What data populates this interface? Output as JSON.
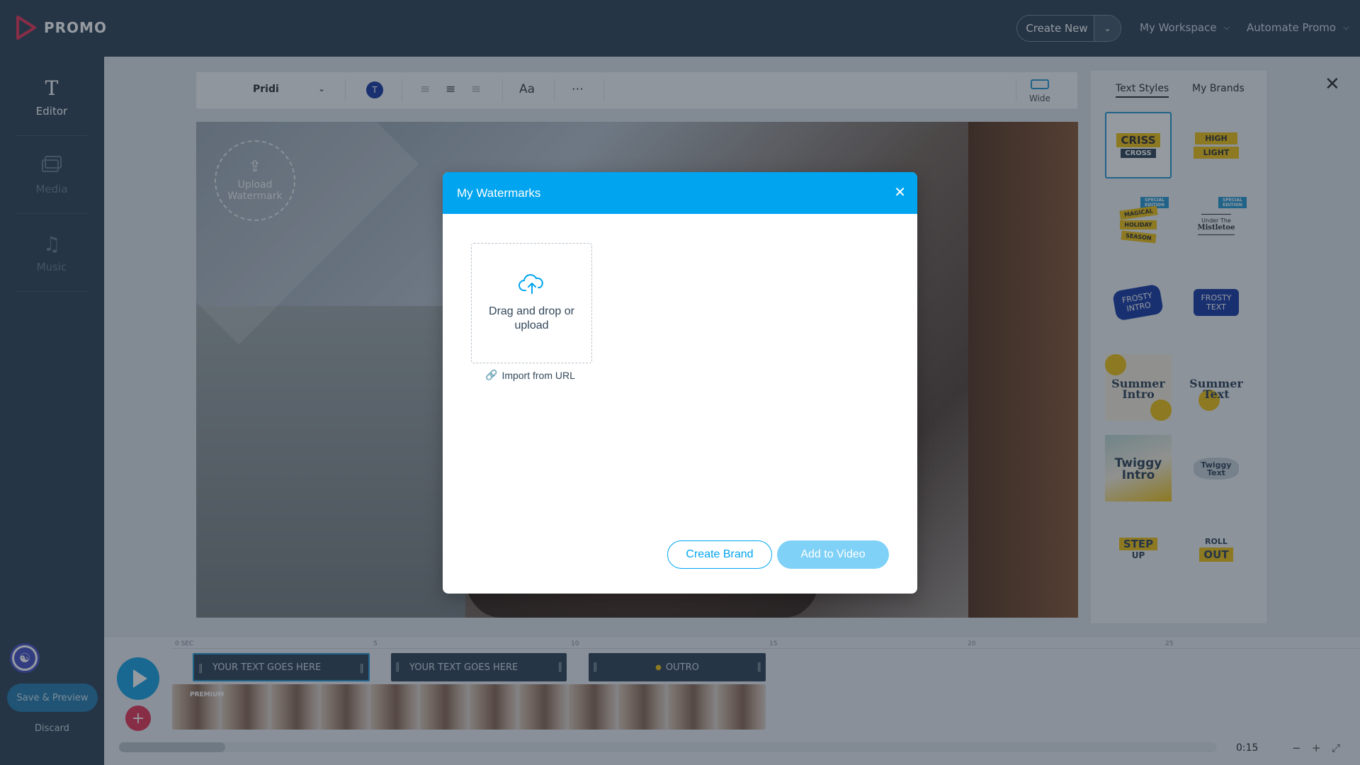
{
  "app": {
    "brand": "PROMO"
  },
  "topnav": {
    "create_new": "Create New",
    "workspace": "My Workspace",
    "automate": "Automate Promo"
  },
  "sidebar": {
    "items": [
      {
        "label": "Editor",
        "icon": "text-icon"
      },
      {
        "label": "Media",
        "icon": "media-icon"
      },
      {
        "label": "Music",
        "icon": "music-icon"
      }
    ],
    "save_preview": "Save & Preview",
    "discard": "Discard"
  },
  "toolbar": {
    "font": "Pridi",
    "color_letter": "T",
    "text_size_label": "Aa",
    "aspect_label": "Wide"
  },
  "canvas": {
    "upload_watermark": "Upload Watermark"
  },
  "right_panel": {
    "tabs": [
      "Text Styles",
      "My Brands"
    ],
    "styles": [
      {
        "line1": "CRISS",
        "line2": "CROSS"
      },
      {
        "line1": "HIGH",
        "line2": "LIGHT"
      },
      {
        "line1": "MAGICAL",
        "line2": "HOLIDAY",
        "line3": "SEASON",
        "badge": "SPECIAL EDITION"
      },
      {
        "line1": "Under The",
        "line2": "Mistletoe",
        "badge": "SPECIAL EDITION"
      },
      {
        "line1": "FROSTY",
        "line2": "INTRO"
      },
      {
        "line1": "FROSTY",
        "line2": "TEXT"
      },
      {
        "line1": "Summer",
        "line2": "Intro"
      },
      {
        "line1": "Summer",
        "line2": "Text"
      },
      {
        "line1": "Twiggy",
        "line2": "Intro"
      },
      {
        "line1": "Twiggy",
        "line2": "Text"
      },
      {
        "line1": "STEP",
        "line2": "UP"
      },
      {
        "line1": "ROLL",
        "line2": "OUT"
      }
    ]
  },
  "timeline": {
    "ticks": [
      "0 SEC",
      "5",
      "10",
      "15",
      "20",
      "25"
    ],
    "clips": [
      {
        "label": "YOUR TEXT GOES HERE"
      },
      {
        "label": "YOUR TEXT GOES HERE"
      },
      {
        "label": "OUTRO"
      }
    ],
    "premium": "PREMIUM",
    "duration": "0:15"
  },
  "modal": {
    "title": "My Watermarks",
    "dropzone_text": "Drag and drop or upload",
    "import_url": "Import from URL",
    "create_brand": "Create Brand",
    "add_to_video": "Add to Video"
  },
  "colors": {
    "nav": "#33475b",
    "accent": "#00a4ef",
    "add_button": "#e83a5c"
  }
}
